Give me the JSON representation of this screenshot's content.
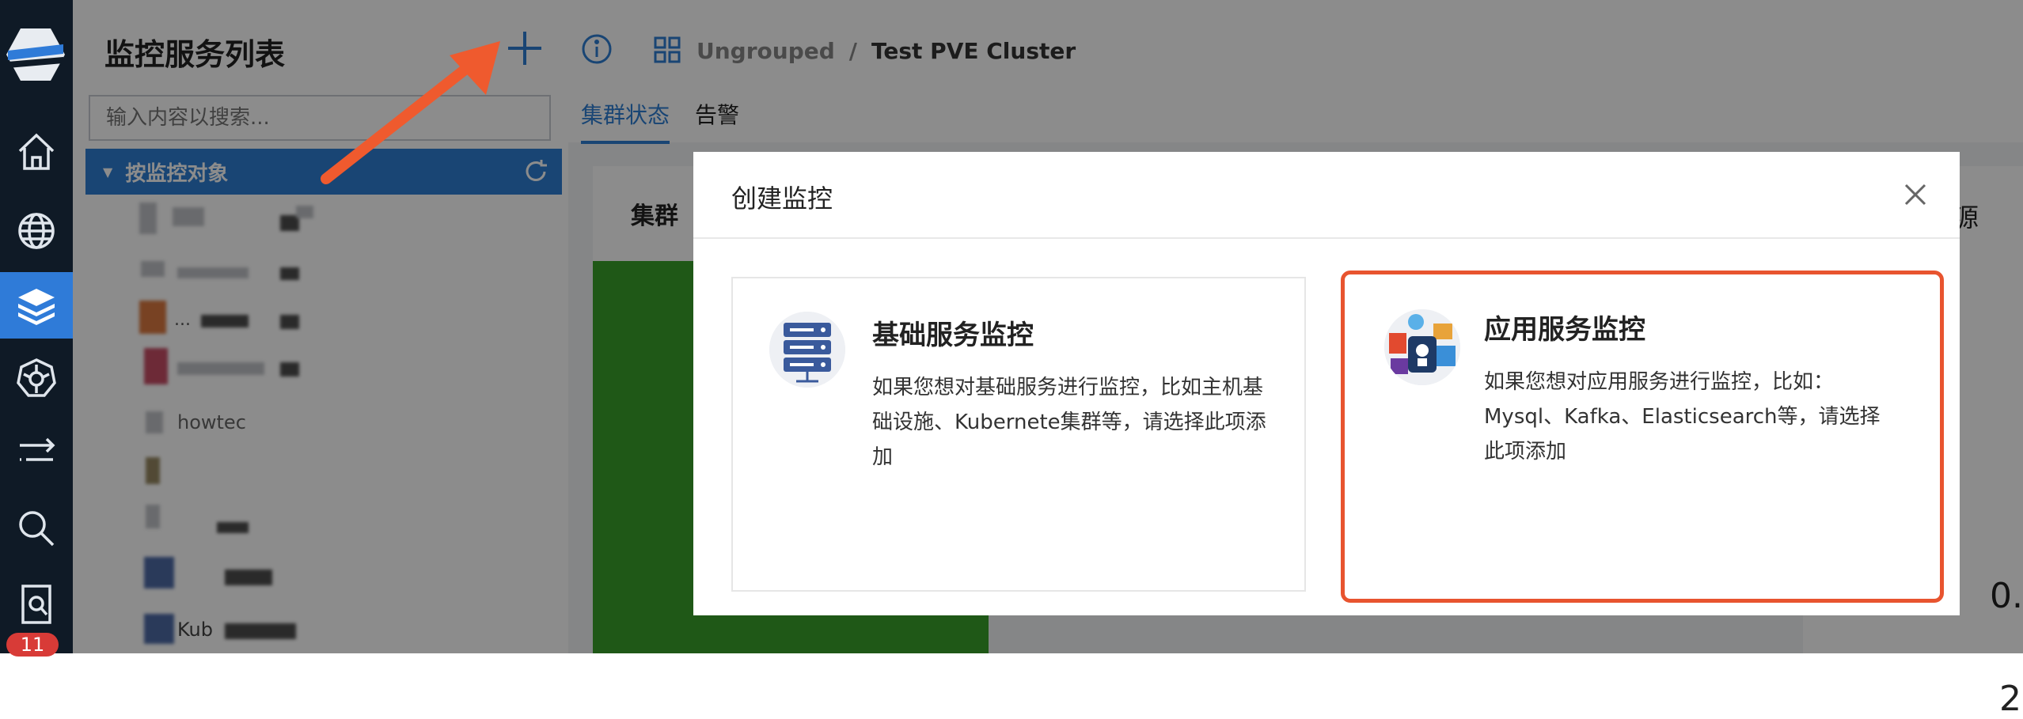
{
  "rail": {
    "badge": "11",
    "items": [
      "home-icon",
      "globe-icon",
      "layers-icon",
      "kubernetes-icon",
      "flow-icon",
      "search-icon",
      "report-icon"
    ]
  },
  "panel": {
    "title": "监控服务列表",
    "search_placeholder": "输入内容以搜索...",
    "tree_group": "按监控对象",
    "items": [
      {
        "label": ""
      },
      {
        "label": ""
      },
      {
        "label": "..."
      },
      {
        "label": ""
      },
      {
        "label": "howtec"
      },
      {
        "label": ""
      },
      {
        "label": ""
      },
      {
        "label": ""
      },
      {
        "label": "Kub"
      }
    ]
  },
  "main": {
    "breadcrumb": {
      "group": "Ungrouped",
      "separator": "/",
      "cluster": "Test PVE Cluster"
    },
    "tabs": [
      {
        "label": "集群状态",
        "active": true
      },
      {
        "label": "告警",
        "active": false
      }
    ],
    "card_title": "集群",
    "right_peek": {
      "title": "源",
      "value1": "0.",
      "value2": "2"
    }
  },
  "modal": {
    "title": "创建监控",
    "options": [
      {
        "title": "基础服务监控",
        "desc": "如果您想对基础服务进行监控，比如主机基础设施、Kubernete集群等，请选择此项添加",
        "selected": false
      },
      {
        "title": "应用服务监控",
        "desc": "如果您想对应用服务进行监控，比如：Mysql、Kafka、Elasticsearch等，请选择此项添加",
        "selected": true
      }
    ]
  },
  "colors": {
    "accent": "#2e7fd3",
    "highlight": "#e8542f",
    "rail": "#0f1a26",
    "badge": "#d83b37"
  }
}
